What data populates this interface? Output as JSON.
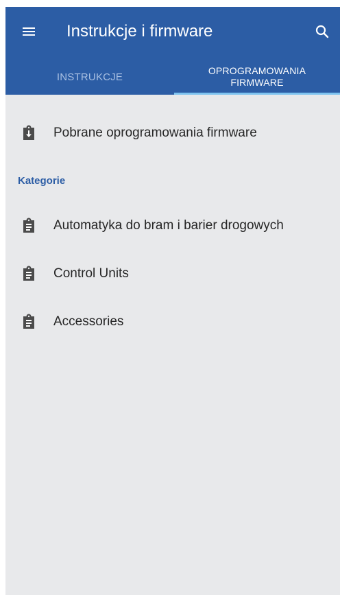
{
  "app": {
    "title": "Instrukcje i firmware",
    "accent_color": "#2c5da5",
    "tab_indicator_color": "#7ec4f0"
  },
  "toolbar": {
    "menu_icon": "hamburger-menu-icon",
    "search_icon": "search-icon"
  },
  "tabs": [
    {
      "label": "INSTRUKCJE",
      "selected": false
    },
    {
      "label": "OPROGRAMOWANIA FIRMWARE",
      "selected": true
    }
  ],
  "downloaded": {
    "label": "Pobrane oprogramowania firmware",
    "icon": "clipboard-download-icon"
  },
  "categories": {
    "header": "Kategorie",
    "items": [
      {
        "label": "Automatyka do bram i barier drogowych",
        "icon": "clipboard-text-icon"
      },
      {
        "label": "Control Units",
        "icon": "clipboard-text-icon"
      },
      {
        "label": "Accessories",
        "icon": "clipboard-text-icon"
      }
    ]
  }
}
